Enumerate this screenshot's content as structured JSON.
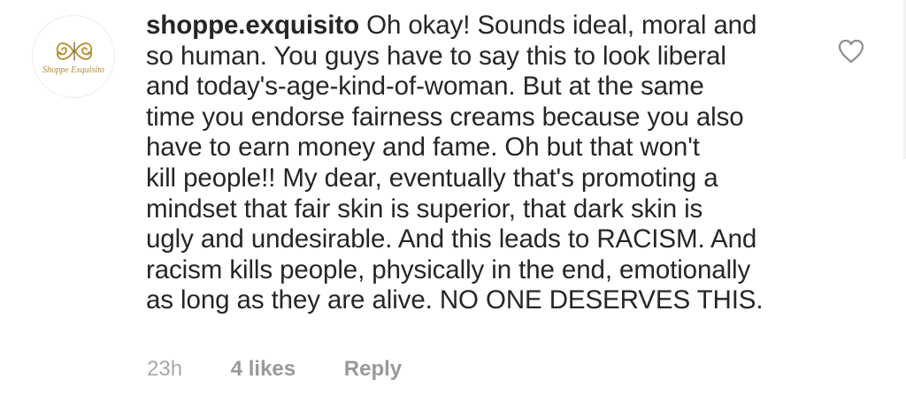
{
  "comment": {
    "avatar": {
      "brand_text": "Shoppe Exquisito",
      "brand_color": "#b58a2a"
    },
    "username": "shoppe.exquisito",
    "text_lines": [
      "Oh okay! Sounds ideal, moral and",
      "so human. You guys have to say this to look liberal",
      "and today's-age-kind-of-woman. But at the same",
      "time you endorse fairness creams because you also",
      "have to earn money and fame. Oh but that won't",
      "kill people!! My dear, eventually that's promoting a",
      "mindset that fair skin is superior, that dark skin is",
      "ugly and undesirable. And this leads to RACISM. And",
      "racism kills people, physically in the end, emotionally",
      "as long as they are alive. NO ONE DESERVES THIS."
    ],
    "like_icon": "heart-outline-icon",
    "meta": {
      "timestamp": "23h",
      "likes": "4 likes",
      "reply": "Reply"
    }
  },
  "colors": {
    "text": "#262626",
    "secondary": "#999999",
    "icon": "#8e8e8e"
  }
}
